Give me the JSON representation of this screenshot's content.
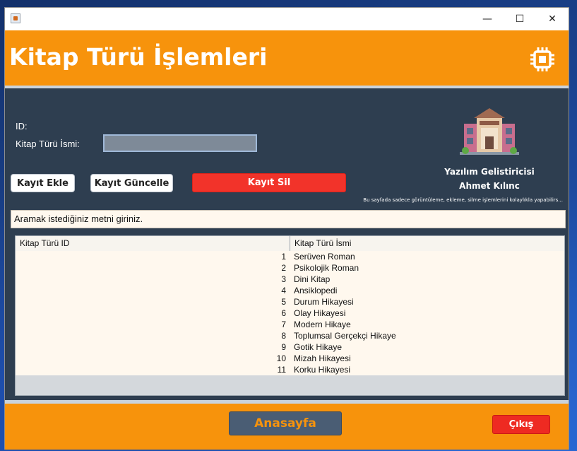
{
  "window": {
    "minimize_glyph": "—",
    "maximize_glyph": "☐",
    "close_glyph": "✕"
  },
  "header": {
    "title": "Kitap Türü İşlemleri",
    "icon": "chip-icon"
  },
  "form": {
    "id_label": "ID:",
    "name_label": "Kitap Türü İsmi:",
    "name_value": "",
    "add_button": "Kayıt Ekle",
    "update_button": "Kayıt Güncelle",
    "delete_button": "Kayıt Sil"
  },
  "developer": {
    "title": "Yazılım Gelistiricisi",
    "name": "Ahmet Kılınc",
    "note": "Bu sayfada sadece görüntüleme, ekleme, silme işlemlerini kolaylıkla yapabilirs..."
  },
  "search": {
    "text": "Aramak istediğiniz metni giriniz."
  },
  "table": {
    "columns": [
      "Kitap Türü ID",
      "Kitap Türü İsmi"
    ],
    "rows": [
      {
        "id": "1",
        "name": "Serüven Roman"
      },
      {
        "id": "2",
        "name": "Psikolojik Roman"
      },
      {
        "id": "3",
        "name": "Dini Kitap"
      },
      {
        "id": "4",
        "name": "Ansiklopedi"
      },
      {
        "id": "5",
        "name": "Durum Hikayesi"
      },
      {
        "id": "6",
        "name": "Olay Hikayesi"
      },
      {
        "id": "7",
        "name": "Modern Hikaye"
      },
      {
        "id": "8",
        "name": "Toplumsal Gerçekçi Hikaye"
      },
      {
        "id": "9",
        "name": "Gotik Hikaye"
      },
      {
        "id": "10",
        "name": "Mizah Hikayesi"
      },
      {
        "id": "11",
        "name": "Korku Hikayesi"
      }
    ]
  },
  "footer": {
    "home_button": "Anasayfa",
    "exit_button": "Çıkış"
  },
  "colors": {
    "accent_orange": "#f7930c",
    "panel_dark": "#2e3e50",
    "danger_red": "#f2332a"
  }
}
